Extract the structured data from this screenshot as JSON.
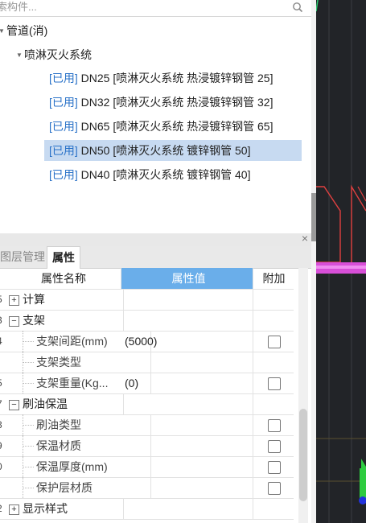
{
  "search": {
    "placeholder": "索构件..."
  },
  "tree": {
    "root": "管道(消)",
    "group": "喷淋灭火系统",
    "items": [
      {
        "tag": "[已用]",
        "text": "DN25 [喷淋灭火系统 热浸镀锌钢管 25]",
        "selected": false
      },
      {
        "tag": "[已用]",
        "text": "DN32 [喷淋灭火系统 热浸镀锌钢管 32]",
        "selected": false
      },
      {
        "tag": "[已用]",
        "text": "DN65 [喷淋灭火系统 热浸镀锌钢管 65]",
        "selected": false
      },
      {
        "tag": "[已用]",
        "text": "DN50 [喷淋灭火系统 镀锌钢管 50]",
        "selected": true
      },
      {
        "tag": "[已用]",
        "text": "DN40 [喷淋灭火系统 镀锌钢管 40]",
        "selected": false
      }
    ]
  },
  "panel": {
    "close": "×"
  },
  "tabs": {
    "layers": "图层管理",
    "props": "属性"
  },
  "grid": {
    "headers": {
      "name": "属性名称",
      "value": "属性值",
      "add": "附加"
    },
    "rows": [
      {
        "num": "5",
        "name": "计算",
        "value": "",
        "type": "group",
        "expand": "+",
        "check": false
      },
      {
        "num": "3",
        "name": "支架",
        "value": "",
        "type": "group",
        "expand": "−",
        "check": false
      },
      {
        "num": "4",
        "name": "支架间距(mm)",
        "value": "(5000)",
        "type": "child",
        "check": true
      },
      {
        "num": "",
        "name": "支架类型",
        "value": "",
        "type": "child",
        "check": false
      },
      {
        "num": "5",
        "name": "支架重量(Kg...",
        "value": "(0)",
        "type": "child",
        "check": true
      },
      {
        "num": "7",
        "name": "刷油保温",
        "value": "",
        "type": "group",
        "expand": "−",
        "check": false
      },
      {
        "num": "3",
        "name": "刷油类型",
        "value": "",
        "type": "child",
        "check": true
      },
      {
        "num": "9",
        "name": "保温材质",
        "value": "",
        "type": "child",
        "check": true
      },
      {
        "num": "0",
        "name": "保温厚度(mm)",
        "value": "",
        "type": "child",
        "check": true
      },
      {
        "num": "",
        "name": "保护层材质",
        "value": "",
        "type": "child",
        "check": true
      },
      {
        "num": "2",
        "name": "显示样式",
        "value": "",
        "type": "group",
        "expand": "+",
        "check": false
      }
    ]
  }
}
